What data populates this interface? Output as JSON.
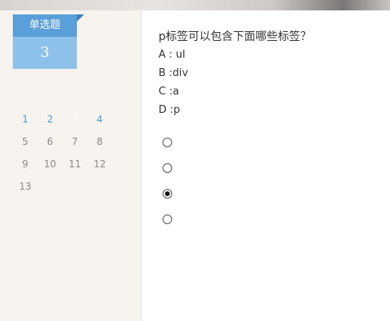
{
  "question_type": {
    "label": "单选题",
    "number": "3"
  },
  "navigator": {
    "items": [
      {
        "label": "1",
        "state": "answered"
      },
      {
        "label": "2",
        "state": "answered"
      },
      {
        "label": "3",
        "state": "current"
      },
      {
        "label": "4",
        "state": "answered"
      },
      {
        "label": "5",
        "state": "unanswered"
      },
      {
        "label": "6",
        "state": "unanswered"
      },
      {
        "label": "7",
        "state": "unanswered"
      },
      {
        "label": "8",
        "state": "unanswered"
      },
      {
        "label": "9",
        "state": "unanswered"
      },
      {
        "label": "10",
        "state": "unanswered"
      },
      {
        "label": "11",
        "state": "unanswered"
      },
      {
        "label": "12",
        "state": "unanswered"
      },
      {
        "label": "13",
        "state": "unanswered"
      }
    ]
  },
  "question": {
    "title": "p标签可以包含下面哪些标签？",
    "options": [
      {
        "text": "A : ul",
        "selected": false
      },
      {
        "text": "B :div",
        "selected": false
      },
      {
        "text": "C :a",
        "selected": true
      },
      {
        "text": "D :p",
        "selected": false
      }
    ]
  },
  "colors": {
    "tag_blue": "#5a9fd9",
    "tag_light_blue": "#8ec1ea",
    "current_teal": "#4bb5a1",
    "answered_blue": "#4a9fe0"
  }
}
